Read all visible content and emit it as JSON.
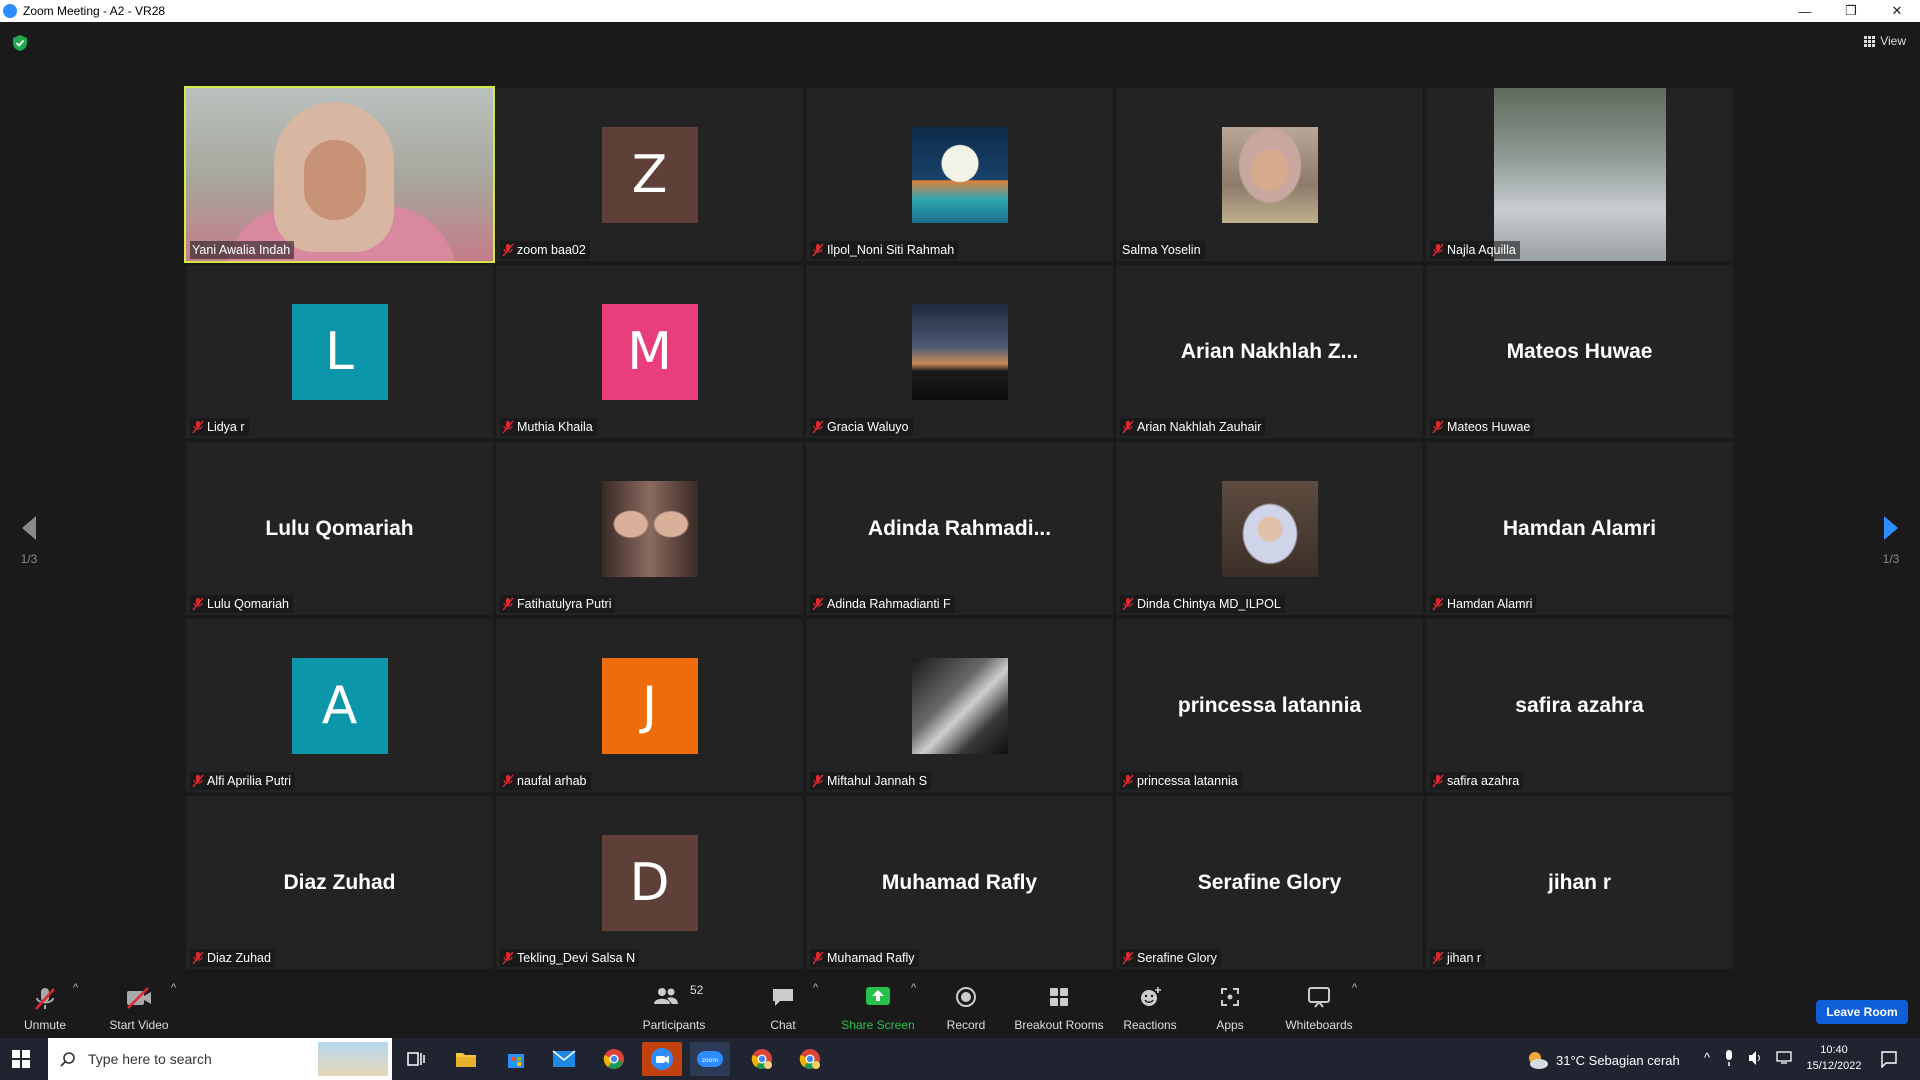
{
  "window": {
    "title": "Zoom Meeting - A2 - VR28",
    "controls": [
      "—",
      "❐",
      "✕"
    ]
  },
  "top_right": {
    "view_label": "View"
  },
  "pagination": {
    "left": "1/3",
    "right": "1/3"
  },
  "participants": [
    {
      "label": "Yani Awalia Indah",
      "kind": "camera",
      "muted": false,
      "active": true
    },
    {
      "label": "zoom baa02",
      "kind": "letter",
      "letter": "Z",
      "color": "#5e4039",
      "muted": true
    },
    {
      "label": "Ilpol_Noni Siti Rahmah",
      "kind": "photo-city",
      "muted": true
    },
    {
      "label": "Salma Yoselin",
      "kind": "photo-selfie",
      "muted": false
    },
    {
      "label": "Najla Aquilla",
      "kind": "photo-street",
      "muted": true
    },
    {
      "label": "Lidya r",
      "kind": "letter",
      "letter": "L",
      "color": "#0c96a9",
      "muted": true
    },
    {
      "label": "Muthia Khaila",
      "kind": "letter",
      "letter": "M",
      "color": "#e83e7b",
      "muted": true
    },
    {
      "label": "Gracia Waluyo",
      "kind": "photo-sunset",
      "muted": true
    },
    {
      "label": "Arian Nakhlah Zauhair",
      "kind": "name",
      "display": "Arian  Nakhlah  Z...",
      "muted": true
    },
    {
      "label": "Mateos Huwae",
      "kind": "name",
      "display": "Mateos Huwae",
      "muted": true
    },
    {
      "label": "Lulu Qomariah",
      "kind": "name",
      "display": "Lulu Qomariah",
      "muted": true
    },
    {
      "label": "Fatihatulyra Putri",
      "kind": "photo-pair",
      "muted": true
    },
    {
      "label": "Adinda Rahmadianti F",
      "kind": "name",
      "display": "Adinda  Rahmadi...",
      "muted": true
    },
    {
      "label": "Dinda Chintya MD_ILPOL",
      "kind": "photo-hijab",
      "muted": true
    },
    {
      "label": "Hamdan Alamri",
      "kind": "name",
      "display": "Hamdan Alamri",
      "muted": true
    },
    {
      "label": "Alfi Aprilia Putri",
      "kind": "letter",
      "letter": "A",
      "color": "#0c96a9",
      "muted": true
    },
    {
      "label": "naufal arhab",
      "kind": "letter",
      "letter": "J",
      "color": "#ef6c0a",
      "muted": true
    },
    {
      "label": "Miftahul Jannah S",
      "kind": "photo-bw",
      "muted": true
    },
    {
      "label": "princessa latannia",
      "kind": "name",
      "display": "princessa latannia",
      "muted": true
    },
    {
      "label": "safira azahra",
      "kind": "name",
      "display": "safira azahra",
      "muted": true
    },
    {
      "label": "Diaz Zuhad",
      "kind": "name",
      "display": "Diaz Zuhad",
      "muted": true
    },
    {
      "label": "Tekling_Devi Salsa N",
      "kind": "letter",
      "letter": "D",
      "color": "#5e4039",
      "muted": true
    },
    {
      "label": "Muhamad Rafly",
      "kind": "name",
      "display": "Muhamad Rafly",
      "muted": true
    },
    {
      "label": "Serafine Glory",
      "kind": "name",
      "display": "Serafine Glory",
      "muted": true
    },
    {
      "label": "jihan r",
      "kind": "name",
      "display": "jihan r",
      "muted": true
    }
  ],
  "toolbar": {
    "unmute": "Unmute",
    "start_video": "Start Video",
    "participants": "Participants",
    "participants_count": "52",
    "chat": "Chat",
    "share_screen": "Share Screen",
    "record": "Record",
    "breakout_rooms": "Breakout Rooms",
    "reactions": "Reactions",
    "apps": "Apps",
    "whiteboards": "Whiteboards",
    "leave_room": "Leave Room"
  },
  "taskbar": {
    "search_placeholder": "Type here to search",
    "weather": "31°C  Sebagian cerah",
    "time": "10:40",
    "date": "15/12/2022"
  },
  "colors": {
    "active_border": "#d7e84a",
    "muted_icon": "#e0282e",
    "share_green": "#27c14a",
    "leave_blue": "#0e5fd8"
  }
}
